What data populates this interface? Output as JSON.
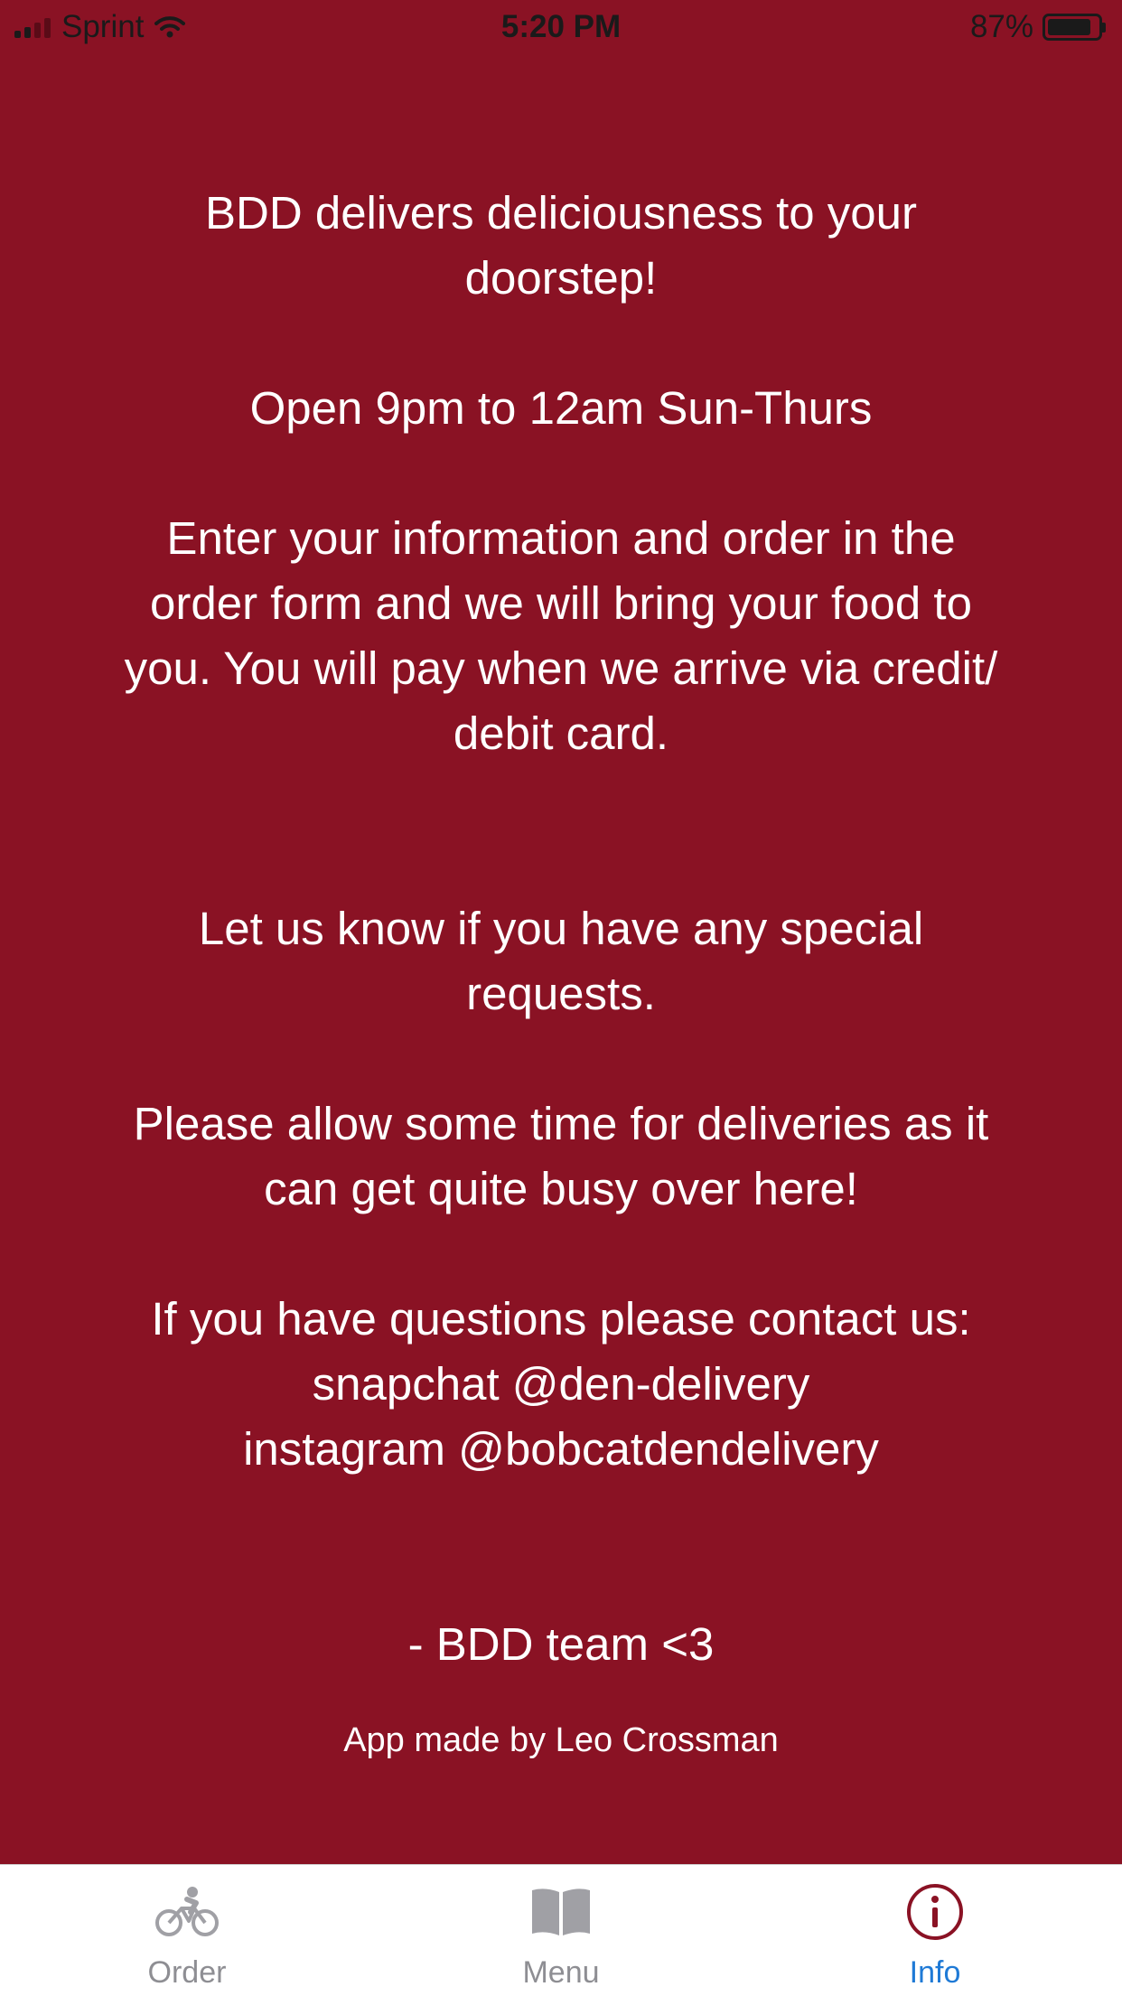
{
  "status_bar": {
    "carrier": "Sprint",
    "time": "5:20 PM",
    "battery_percent": "87%",
    "battery_level": 0.87
  },
  "info": {
    "p1": [
      "BDD delivers deliciousness to your",
      "doorstep!"
    ],
    "p2": [
      "Open 9pm to 12am Sun-Thurs"
    ],
    "p3": [
      "Enter your information and order in the",
      "order form and we will bring your food to",
      "you. You will pay when we arrive via credit/",
      "debit card."
    ],
    "p4": [
      "Let us know if you have any special",
      "requests."
    ],
    "p5": [
      "Please allow some time for deliveries as it",
      "can get quite busy over here!"
    ],
    "p6": [
      "If you have questions please contact us:",
      "snapchat @den-delivery",
      "instagram @bobcatdendelivery"
    ],
    "p7": [
      "- BDD team <3"
    ],
    "credit": "App made by Leo Crossman"
  },
  "tabs": [
    {
      "label": "Order",
      "icon": "bicycle-icon",
      "active": false
    },
    {
      "label": "Menu",
      "icon": "book-icon",
      "active": false
    },
    {
      "label": "Info",
      "icon": "info-circle-icon",
      "active": true
    }
  ],
  "colors": {
    "background": "#8a1224",
    "tab_active": "#1f7ad6",
    "tab_inactive": "#8e8e93"
  }
}
